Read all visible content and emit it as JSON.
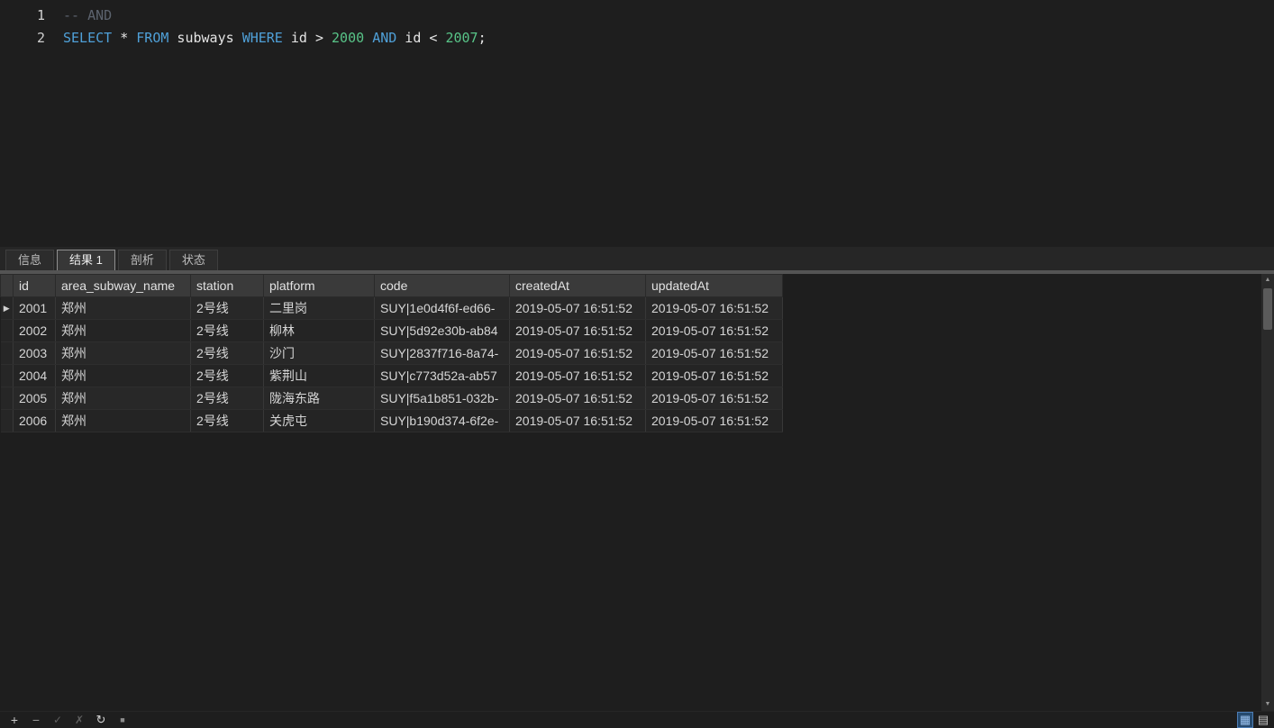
{
  "editor": {
    "lines": [
      {
        "number": "1",
        "segments": [
          {
            "type": "comment",
            "text": "-- AND"
          }
        ]
      },
      {
        "number": "2",
        "segments": [
          {
            "type": "keyword",
            "text": "SELECT"
          },
          {
            "type": "plain",
            "text": " * "
          },
          {
            "type": "keyword",
            "text": "FROM"
          },
          {
            "type": "plain",
            "text": " subways "
          },
          {
            "type": "keyword",
            "text": "WHERE"
          },
          {
            "type": "plain",
            "text": " id > "
          },
          {
            "type": "number",
            "text": "2000"
          },
          {
            "type": "plain",
            "text": " "
          },
          {
            "type": "keyword",
            "text": "AND"
          },
          {
            "type": "plain",
            "text": " id < "
          },
          {
            "type": "number",
            "text": "2007"
          },
          {
            "type": "plain",
            "text": ";"
          }
        ]
      }
    ]
  },
  "tabs": [
    {
      "label": "信息",
      "active": false
    },
    {
      "label": "结果 1",
      "active": true
    },
    {
      "label": "剖析",
      "active": false
    },
    {
      "label": "状态",
      "active": false
    }
  ],
  "table": {
    "columns": [
      "id",
      "area_subway_name",
      "station",
      "platform",
      "code",
      "createdAt",
      "updatedAt"
    ],
    "rows": [
      [
        "2001",
        "郑州",
        "2号线",
        "二里岗",
        "SUY|1e0d4f6f-ed66-",
        "2019-05-07 16:51:52",
        "2019-05-07 16:51:52"
      ],
      [
        "2002",
        "郑州",
        "2号线",
        "柳林",
        "SUY|5d92e30b-ab84",
        "2019-05-07 16:51:52",
        "2019-05-07 16:51:52"
      ],
      [
        "2003",
        "郑州",
        "2号线",
        "沙门",
        "SUY|2837f716-8a74-",
        "2019-05-07 16:51:52",
        "2019-05-07 16:51:52"
      ],
      [
        "2004",
        "郑州",
        "2号线",
        "紫荆山",
        "SUY|c773d52a-ab57",
        "2019-05-07 16:51:52",
        "2019-05-07 16:51:52"
      ],
      [
        "2005",
        "郑州",
        "2号线",
        "陇海东路",
        "SUY|f5a1b851-032b-",
        "2019-05-07 16:51:52",
        "2019-05-07 16:51:52"
      ],
      [
        "2006",
        "郑州",
        "2号线",
        "关虎屯",
        "SUY|b190d374-6f2e-",
        "2019-05-07 16:51:52",
        "2019-05-07 16:51:52"
      ]
    ],
    "current_row_index": 0,
    "marker_glyph": "▶"
  },
  "toolbar": {
    "add": "+",
    "remove": "−",
    "apply": "✓",
    "discard": "✗",
    "refresh": "↻",
    "stop": "■",
    "grid_view": "▦",
    "text_view": "▤"
  },
  "scrollbar": {
    "up": "▲",
    "down": "▼"
  },
  "colors": {
    "keyword": "#4fa0d8",
    "number": "#58c488",
    "comment": "#5c636e",
    "active_view_icon": "#9cc3f0"
  }
}
